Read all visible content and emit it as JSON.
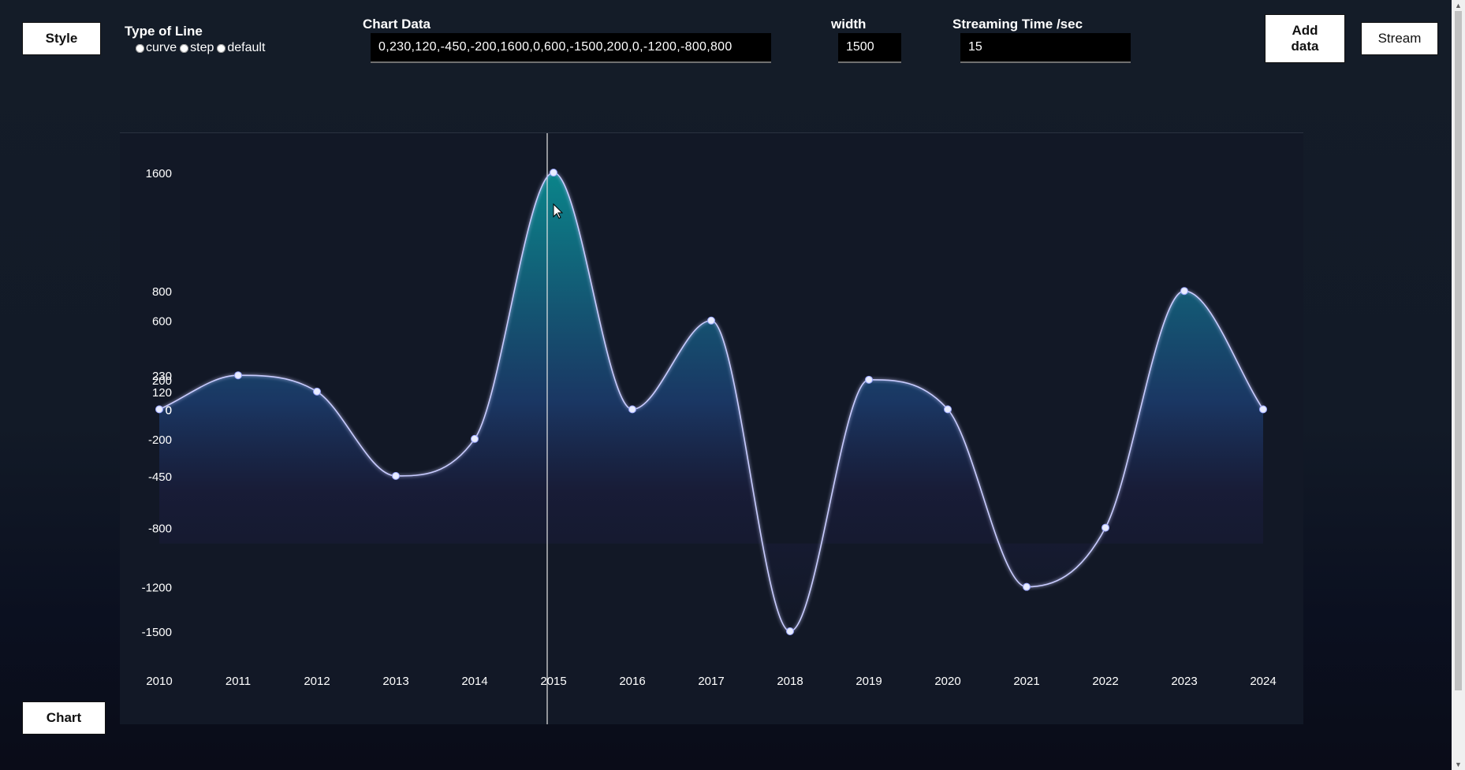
{
  "controls": {
    "style_button": "Style",
    "line_type_label": "Type of Line",
    "line_type_options": [
      "curve",
      "step",
      "default"
    ],
    "chart_data_label": "Chart Data",
    "chart_data_value": "0,230,120,-450,-200,1600,0,600,-1500,200,0,-1200,-800,800",
    "width_label": "width",
    "width_value": "1500",
    "streaming_label": "Streaming Time /sec",
    "streaming_value": "15",
    "add_data_line1": "Add",
    "add_data_line2": "data",
    "stream_button": "Stream",
    "chart_button": "Chart"
  },
  "colors": {
    "line": "#c9ccff",
    "area_top": "#0a8a8f",
    "area_bottom": "#1a1d3d",
    "crosshair": "#e6e6e6",
    "panel": "#121826"
  },
  "chart_data": {
    "type": "area",
    "x": [
      "2010",
      "2011",
      "2012",
      "2013",
      "2014",
      "2015",
      "2016",
      "2017",
      "2018",
      "2019",
      "2020",
      "2021",
      "2022",
      "2023",
      "2024"
    ],
    "values": [
      0,
      230,
      120,
      -450,
      -200,
      1600,
      0,
      600,
      -1500,
      200,
      0,
      -1200,
      -800,
      800,
      0
    ],
    "y_ticks": [
      1600,
      800,
      600,
      230,
      200,
      120,
      0,
      0,
      -200,
      -450,
      -800,
      -1200,
      -1500
    ],
    "ylim": [
      -1500,
      1600
    ],
    "curve": "smooth",
    "hover_category": "2015",
    "grid": false
  }
}
